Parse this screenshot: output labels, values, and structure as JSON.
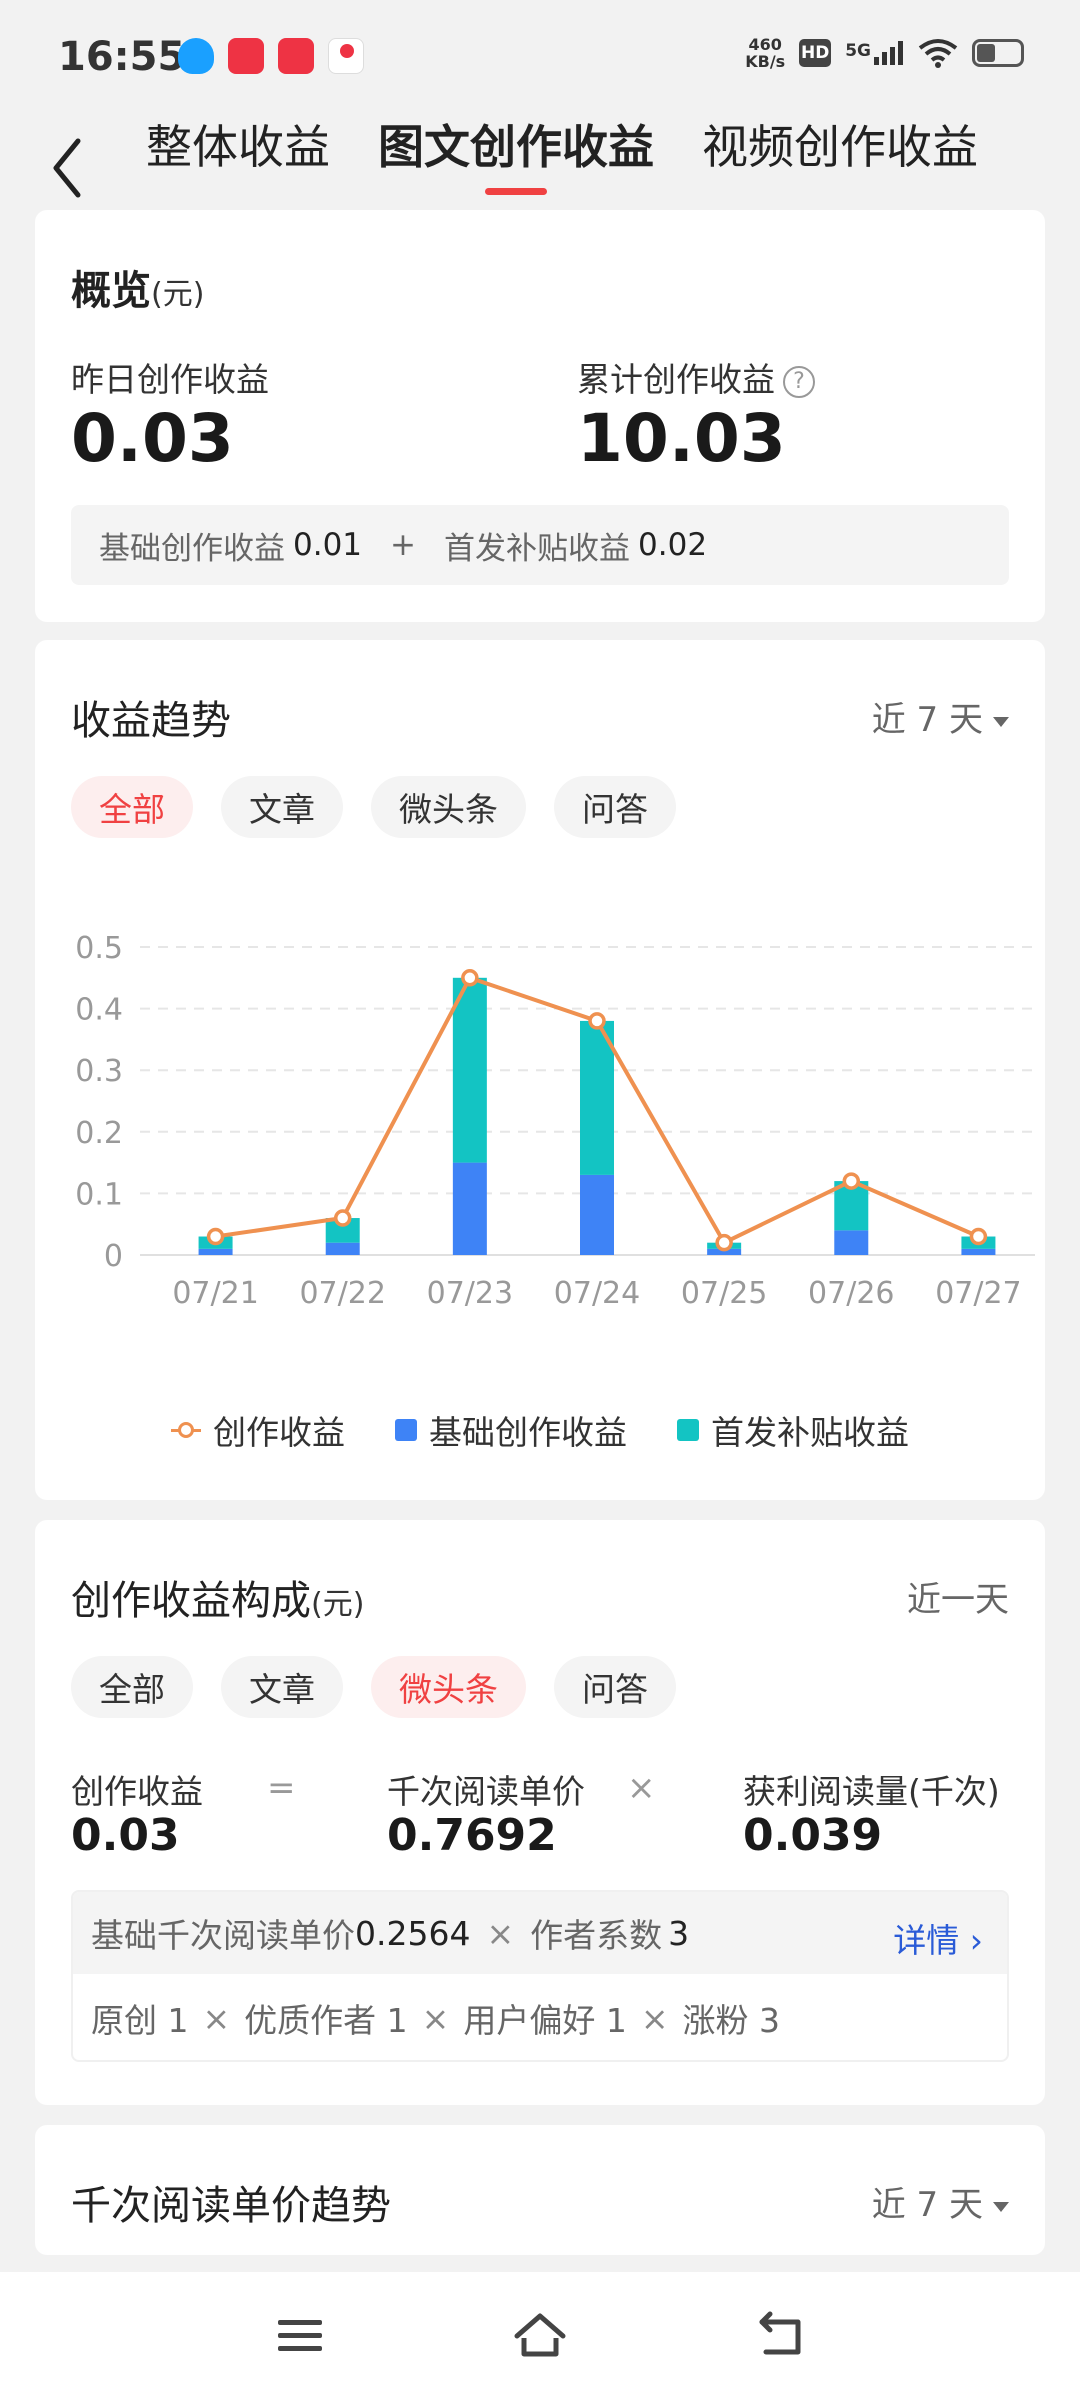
{
  "status_bar": {
    "time": "16:55",
    "net_speed_value": "460",
    "net_speed_unit": "KB/s",
    "hd": "HD",
    "network": "5G",
    "app_icon_colors": [
      "#1aa0ff",
      "#ee3344",
      "#ee3344",
      "#ffffff"
    ]
  },
  "header": {
    "tabs": [
      {
        "label": "整体收益",
        "active": false
      },
      {
        "label": "图文创作收益",
        "active": true
      },
      {
        "label": "视频创作收益",
        "active": false
      }
    ]
  },
  "overview": {
    "title": "概览",
    "unit": "(元)",
    "yesterday_label": "昨日创作收益",
    "yesterday_value": "0.03",
    "total_label": "累计创作收益",
    "total_value": "10.03",
    "breakdown": {
      "base_label": "基础创作收益",
      "base_value": "0.01",
      "plus": "+",
      "subsidy_label": "首发补贴收益",
      "subsidy_value": "0.02"
    }
  },
  "trend": {
    "title": "收益趋势",
    "range": "近 7 天",
    "filters": [
      {
        "label": "全部",
        "selected": true
      },
      {
        "label": "文章",
        "selected": false
      },
      {
        "label": "微头条",
        "selected": false
      },
      {
        "label": "问答",
        "selected": false
      }
    ],
    "legend": [
      "创作收益",
      "基础创作收益",
      "首发补贴收益"
    ]
  },
  "chart_data": {
    "type": "bar",
    "categories": [
      "07/21",
      "07/22",
      "07/23",
      "07/24",
      "07/25",
      "07/26",
      "07/27"
    ],
    "series": [
      {
        "name": "基础创作收益",
        "kind": "bar-stacked",
        "color": "#3e83f6",
        "values": [
          0.01,
          0.02,
          0.15,
          0.13,
          0.01,
          0.04,
          0.01
        ]
      },
      {
        "name": "首发补贴收益",
        "kind": "bar-stacked",
        "color": "#13c4c3",
        "values": [
          0.02,
          0.04,
          0.3,
          0.25,
          0.01,
          0.08,
          0.02
        ]
      },
      {
        "name": "创作收益",
        "kind": "line",
        "color": "#ef9150",
        "values": [
          0.03,
          0.06,
          0.45,
          0.38,
          0.02,
          0.12,
          0.03
        ]
      }
    ],
    "yticks": [
      "0",
      "0.1",
      "0.2",
      "0.3",
      "0.4",
      "0.5"
    ],
    "ylim": [
      0,
      0.5
    ],
    "grid": true,
    "legend_position": "bottom"
  },
  "composition": {
    "title": "创作收益构成",
    "unit": "(元)",
    "range": "近一天",
    "filters": [
      {
        "label": "全部",
        "selected": false
      },
      {
        "label": "文章",
        "selected": false
      },
      {
        "label": "微头条",
        "selected": true
      },
      {
        "label": "问答",
        "selected": false
      }
    ],
    "formula": {
      "income_label": "创作收益",
      "income_value": "0.03",
      "eq": "=",
      "price_label": "千次阅读单价",
      "price_value": "0.7692",
      "times": "×",
      "reads_label": "获利阅读量(千次)",
      "reads_value": "0.039"
    },
    "detail": {
      "base_price_label": "基础千次阅读单价",
      "base_price_value": "0.2564",
      "x": "×",
      "coef_label": "作者系数",
      "coef_value": "3",
      "link": "详情",
      "factors": [
        {
          "label": "原创",
          "value": "1"
        },
        {
          "label": "优质作者",
          "value": "1"
        },
        {
          "label": "用户偏好",
          "value": "1"
        },
        {
          "label": "涨粉",
          "value": "3"
        }
      ]
    }
  },
  "price_trend": {
    "title": "千次阅读单价趋势",
    "range": "近 7 天"
  }
}
